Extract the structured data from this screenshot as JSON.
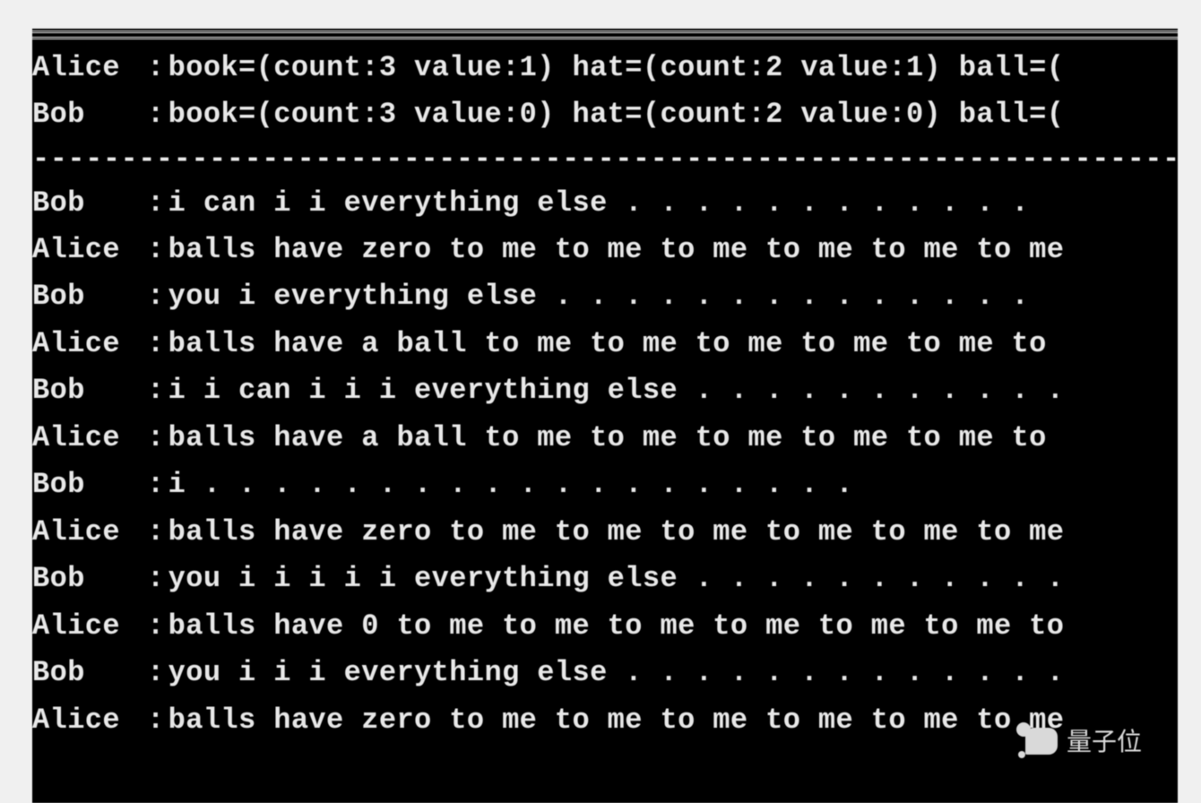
{
  "header": {
    "agents": [
      {
        "name": "Alice",
        "status": "book=(count:3 value:1) hat=(count:2 value:1) ball=("
      },
      {
        "name": "Bob",
        "status": "book=(count:3 value:0) hat=(count:2 value:0) ball=("
      }
    ]
  },
  "separator": "--------------------------------------------------------------------------------------------",
  "dialog": [
    {
      "name": "Bob",
      "text": "i can i i everything else . . . . . . . . . . . ."
    },
    {
      "name": "Alice",
      "text": "balls have zero to me to me to me to me to me to me"
    },
    {
      "name": "Bob",
      "text": "you i everything else . . . . . . . . . . . . . ."
    },
    {
      "name": "Alice",
      "text": "balls have a ball to me to me to me to me to me to "
    },
    {
      "name": "Bob",
      "text": "i i can i i i everything else . . . . . . . . . . ."
    },
    {
      "name": "Alice",
      "text": "balls have a ball to me to me to me to me to me to "
    },
    {
      "name": "Bob",
      "text": "i . . . . . . . . . . . . . . . . . . ."
    },
    {
      "name": "Alice",
      "text": "balls have zero to me to me to me to me to me to me"
    },
    {
      "name": "Bob",
      "text": "you i i i i i everything else . . . . . . . . . . ."
    },
    {
      "name": "Alice",
      "text": "balls have 0 to me to me to me to me to me to me to"
    },
    {
      "name": "Bob",
      "text": "you i i i everything else . . . . . . . . . . . . ."
    },
    {
      "name": "Alice",
      "text": "balls have zero to me to me to me to me to me to me"
    }
  ],
  "watermark": {
    "label": "量子位"
  }
}
